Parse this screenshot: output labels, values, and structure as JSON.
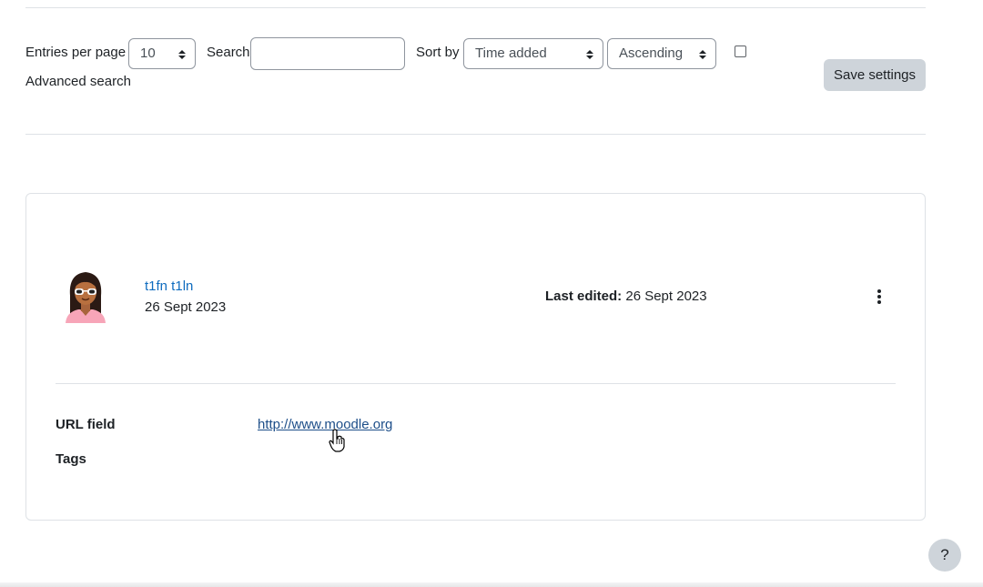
{
  "filters": {
    "entries_label": "Entries per page",
    "entries_value": "10",
    "search_label": "Search",
    "search_value": "",
    "sortby_label": "Sort by",
    "sortby_value": "Time added",
    "order_value": "Ascending",
    "advanced_search_label": "Advanced search",
    "advanced_search_checked": false,
    "save_label": "Save settings"
  },
  "entry": {
    "author_name": "t1fn t1ln",
    "date": "26 Sept 2023",
    "last_edited_label": "Last edited:",
    "last_edited_value": "26 Sept 2023",
    "fields": [
      {
        "label": "URL field",
        "value": "http://www.moodle.org"
      },
      {
        "label": "Tags",
        "value": ""
      }
    ]
  },
  "help": {
    "label": "?"
  },
  "colors": {
    "link": "#0f6cbf",
    "button_bg": "#ced4da",
    "border": "#dee2e6"
  }
}
